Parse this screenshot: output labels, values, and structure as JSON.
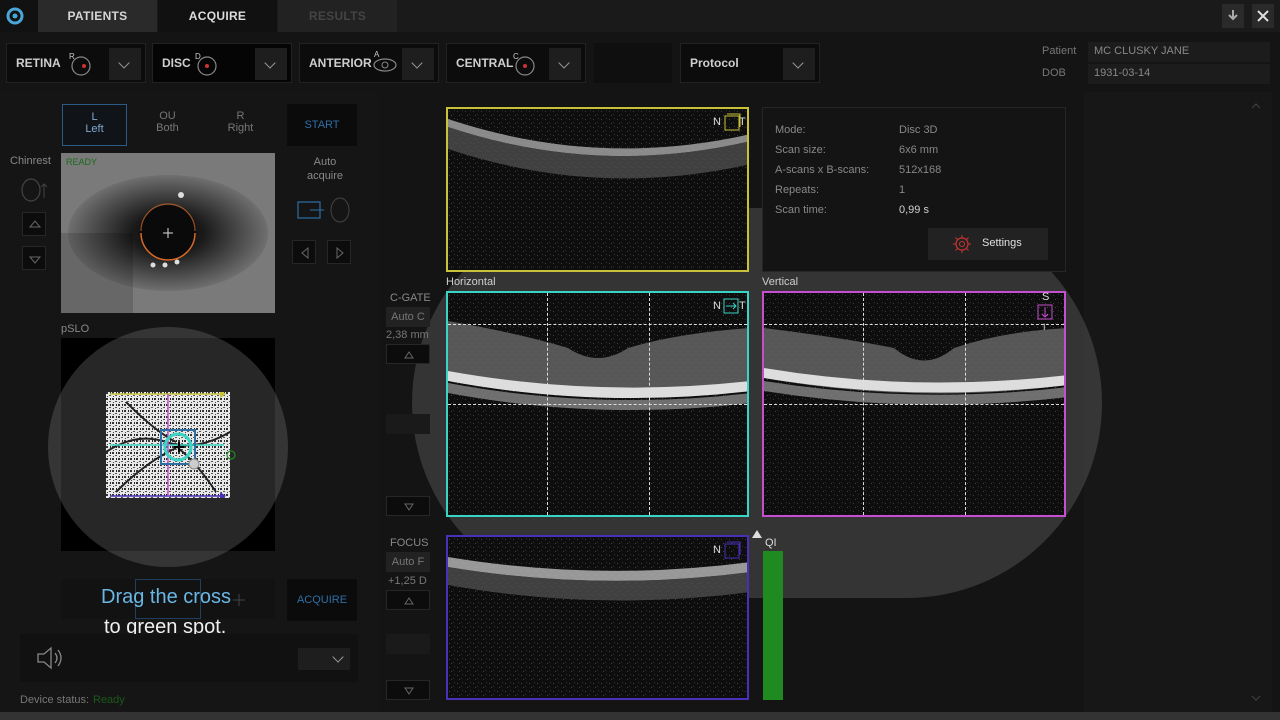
{
  "tabs": {
    "patients": "PATIENTS",
    "acquire": "ACQUIRE",
    "results": "RESULTS"
  },
  "modes": {
    "retina": "RETINA",
    "disc": "DISC",
    "anterior": "ANTERIOR",
    "central": "CENTRAL",
    "protocol": "Protocol",
    "retina_badge": "R",
    "disc_badge": "D",
    "anterior_badge": "A",
    "central_badge": "C"
  },
  "patient": {
    "label": "Patient",
    "name": "MC CLUSKY JANE",
    "dob_label": "DOB",
    "dob": "1931-03-14"
  },
  "eye_select": {
    "left_top": "L",
    "left_bottom": "Left",
    "both_top": "OU",
    "both_bottom": "Both",
    "right_top": "R",
    "right_bottom": "Right"
  },
  "start_label": "START",
  "auto_acquire": "Auto\nacquire",
  "chinrest_label": "Chinrest",
  "pslo_label": "pSLO",
  "acquire_label": "ACQUIRE",
  "tooltip": {
    "line1": "Drag the cross",
    "line2": "to green spot."
  },
  "device_status_label": "Device status:",
  "device_status_value": "Ready",
  "cgate": {
    "label": "C-GATE",
    "auto": "Auto C",
    "value": "2,38 mm"
  },
  "focus": {
    "label": "FOCUS",
    "auto": "Auto F",
    "value": "+1,25 D"
  },
  "scan_info": {
    "mode_label": "Mode:",
    "mode_value": "Disc 3D",
    "size_label": "Scan size:",
    "size_value": "6x6 mm",
    "ascans_label": "A-scans x B-scans:",
    "ascans_value": "512x168",
    "repeats_label": "Repeats:",
    "repeats_value": "1",
    "time_label": "Scan time:",
    "time_value": "0,99 s",
    "settings_label": "Settings"
  },
  "scan_labels": {
    "horizontal": "Horizontal",
    "vertical": "Vertical",
    "qi": "QI",
    "nt_top": "N",
    "t_top": "T",
    "nt_h": "N",
    "t_h": "T",
    "s_v": "S",
    "i_v": "I",
    "n_bottom": "N"
  },
  "colors": {
    "yellow": "#c8c23a",
    "cyan": "#3ad4c4",
    "magenta": "#c64fd0",
    "purple": "#4a2fb8",
    "green": "#1f8a1f",
    "blue_text": "#6ab7e6"
  }
}
